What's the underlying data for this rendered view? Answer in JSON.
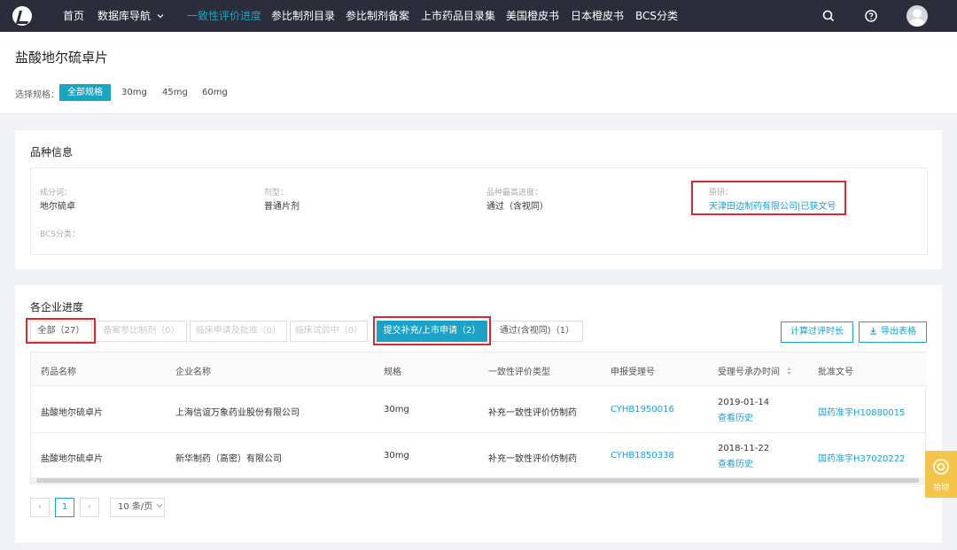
{
  "nav": {
    "items": [
      "首页",
      "数据库导航",
      "一致性评价进度",
      "参比制剂目录",
      "参比制剂备案",
      "上市药品目录集",
      "美国橙皮书",
      "日本橙皮书",
      "BCS分类"
    ],
    "dropdown_icon": "chevron-down-icon",
    "right_icons": [
      "search-icon",
      "help-icon",
      "avatar"
    ]
  },
  "drug": {
    "title": "盐酸地尔硫卓片",
    "spec_label": "选择规格：",
    "specs": [
      "全部规格",
      "30mg",
      "45mg",
      "60mg"
    ]
  },
  "variety_info": {
    "section_title": "品种信息",
    "fields": [
      {
        "label": "成分词：",
        "value": "地尔硫卓"
      },
      {
        "label": "剂型：",
        "value": "普通片剂"
      },
      {
        "label": "品种最高进度：",
        "value": "通过（含视同）"
      },
      {
        "label": "原研：",
        "value": "天津田边制药有限公司|已获文号"
      },
      {
        "label": "BCS分类：",
        "value": ""
      }
    ]
  },
  "progress": {
    "section_title": "各企业进度",
    "filters": [
      "全部（27）",
      "备案参比制剂（0）",
      "临床申请及批准（0）",
      "临床试验中（0）",
      "提交补充/上市申请（2）",
      "通过(含视同)（1）"
    ],
    "actions": [
      "计算过评时长",
      "导出表格"
    ],
    "columns": [
      "药品名称",
      "企业名称",
      "规格",
      "一致性评价类型",
      "申报受理号",
      "受理号承办时间",
      "批准文号"
    ],
    "rows": [
      {
        "drug": "盐酸地尔硫卓片",
        "company": "上海信谊万象药业股份有限公司",
        "spec": "30mg",
        "type": "补充一致性评价仿制药",
        "accept_no": "CYHB1950016",
        "date": "2019-01-14",
        "history": "查看历史",
        "approval": "国药准字H10880015"
      },
      {
        "drug": "盐酸地尔硫卓片",
        "company": "新华制药（高密）有限公司",
        "spec": "30mg",
        "type": "补充一致性评价仿制药",
        "accept_no": "CYHB1850338",
        "date": "2018-11-22",
        "history": "查看历史",
        "approval": "国药准字H37020222"
      }
    ]
  },
  "pagination": {
    "prev": "‹",
    "current": "1",
    "next": "›",
    "page_size": "10 条/页"
  },
  "feedback": {
    "label": "拾动"
  },
  "colors": {
    "accent": "#1aa3c6",
    "nav_bg": "#2b2d3a",
    "link": "#1a9fd6",
    "highlight": "#d9282f",
    "feedback": "#f3c54a"
  }
}
